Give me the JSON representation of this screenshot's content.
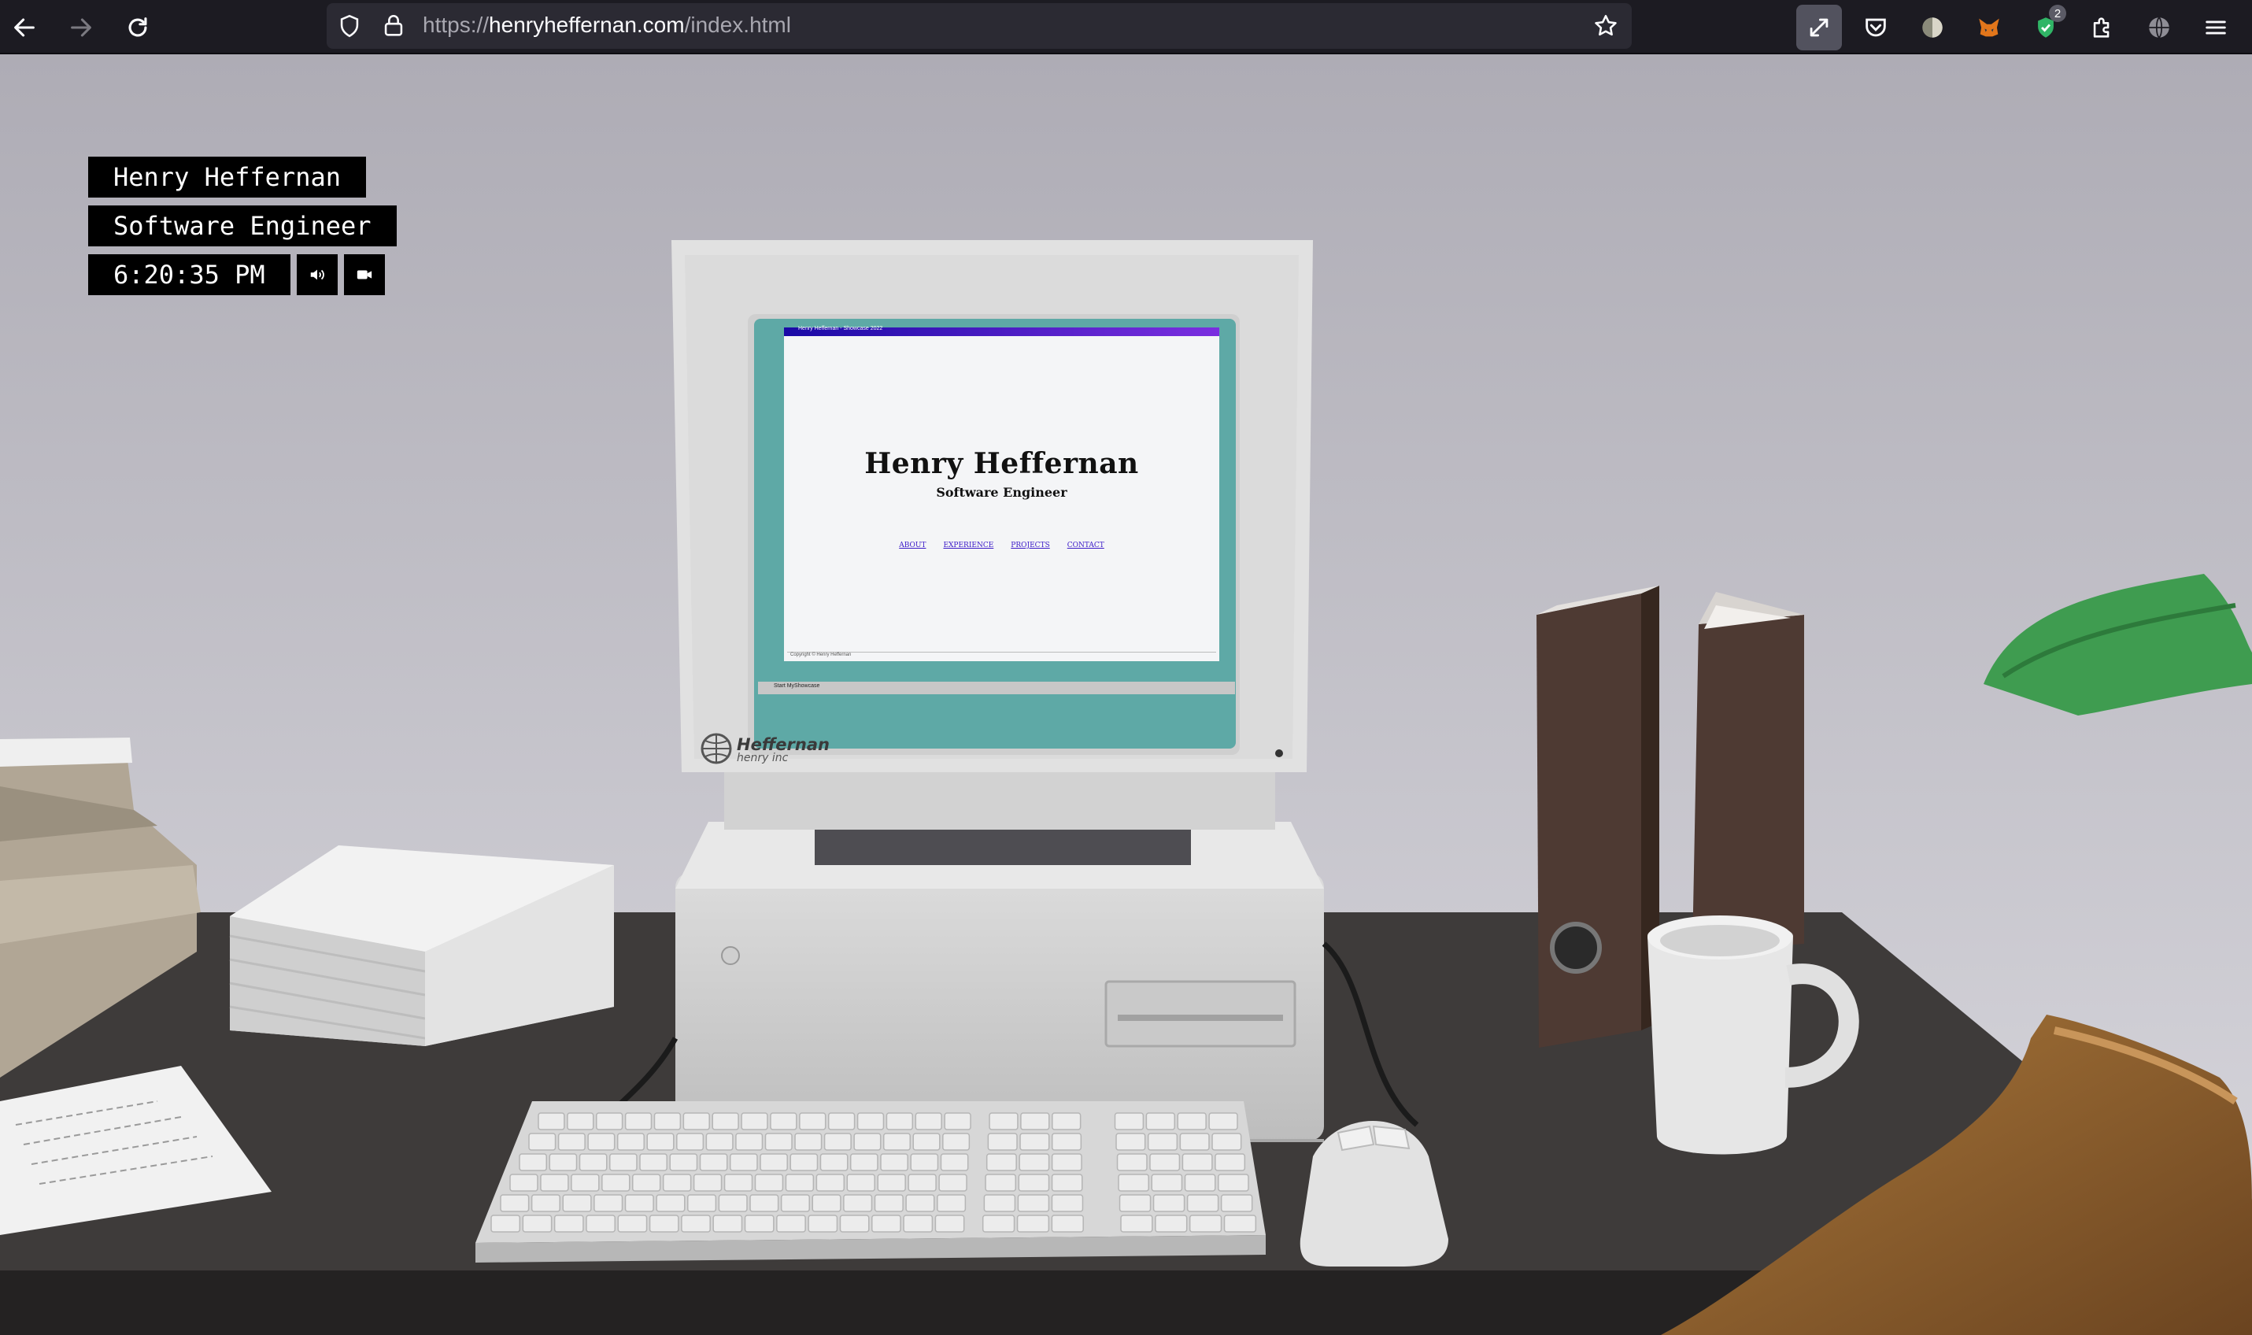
{
  "browser": {
    "url_prefix": "https://",
    "url_domain": "henryheffernan.com",
    "url_path": "/index.html",
    "ext_badge": "2",
    "icons": [
      "back-arrow-icon",
      "forward-arrow-icon",
      "reload-icon",
      "shield-icon",
      "lock-icon",
      "star-icon",
      "fullscreen-icon",
      "pocket-icon",
      "extension-avatar-icon",
      "metamask-icon",
      "shield-badge-icon",
      "puzzle-icon",
      "globe-icon",
      "hamburger-menu-icon"
    ]
  },
  "overlay": {
    "name": "Henry Heffernan",
    "title": "Software Engineer",
    "time": "6:20:35 PM",
    "icons": [
      "volume-icon",
      "camera-icon"
    ]
  },
  "monitor": {
    "window_title": "Henry Heffernan - Showcase 2022",
    "heading": "Henry Heffernan",
    "subheading": "Software Engineer",
    "nav": [
      "ABOUT",
      "EXPERIENCE",
      "PROJECTS",
      "CONTACT"
    ],
    "status": "Copyright © Henry Heffernan",
    "taskbar": "Start  MyShowcase",
    "brand": "Heffernan",
    "brand_sub": "henry inc"
  },
  "colors": {
    "wall": "#bcbac2",
    "desk": "#3e3b3a",
    "crt_teal": "#5ea9a6",
    "link": "#3b1ac8"
  }
}
